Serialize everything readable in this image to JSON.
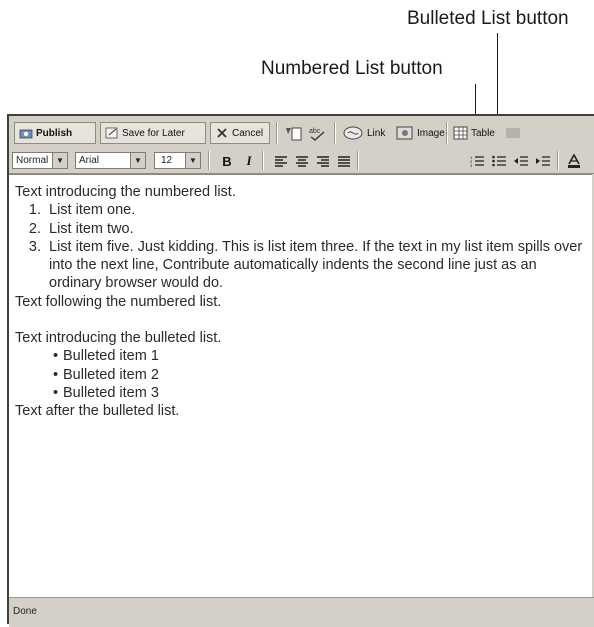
{
  "callouts": {
    "bulleted": "Bulleted List button",
    "numbered": "Numbered List button"
  },
  "toolbar": {
    "publish": "Publish",
    "save_for_later": "Save for Later",
    "cancel": "Cancel",
    "link": "Link",
    "image": "Image",
    "table": "Table"
  },
  "format_bar": {
    "style": "Normal",
    "font": "Arial",
    "size": "12",
    "bold": "B",
    "italic": "I"
  },
  "document": {
    "intro_numbered": "Text introducing the numbered list.",
    "numbered_items": [
      "List item one.",
      "List item two.",
      "List item five. Just kidding. This is list item three. If the text in my list item spills over into the next line, Contribute automatically indents the second line just as an ordinary browser would do."
    ],
    "after_numbered": "Text following the numbered list.",
    "intro_bulleted": "Text introducing the bulleted list.",
    "bulleted_items": [
      "Bulleted item 1",
      "Bulleted item 2",
      "Bulleted item 3"
    ],
    "after_bulleted": "Text after the bulleted list."
  },
  "status": "Done"
}
